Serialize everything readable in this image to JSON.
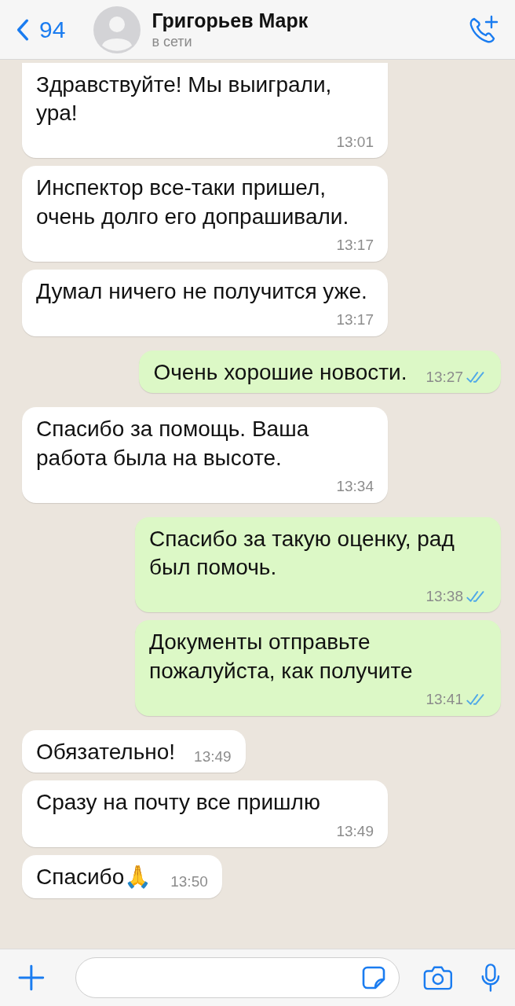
{
  "header": {
    "back_count": "94",
    "contact_name": "Григорьев Марк",
    "status": "в сети"
  },
  "messages": [
    {
      "kind": "incoming",
      "text": "Здравствуйте! Мы выиграли, ура!",
      "time": "13:01"
    },
    {
      "kind": "incoming",
      "text": "Инспектор все-таки пришел, очень долго его допрашивали.",
      "time": "13:17"
    },
    {
      "kind": "incoming",
      "text": "Думал ничего не получится уже.",
      "time": "13:17"
    },
    {
      "kind": "outgoing",
      "text": "Очень хорошие новости.",
      "time": "13:27",
      "read": true
    },
    {
      "kind": "incoming",
      "text": "Спасибо за помощь. Ваша работа была на высоте.",
      "time": "13:34"
    },
    {
      "kind": "outgoing",
      "text": "Спасибо за такую оценку, рад был помочь.",
      "time": "13:38",
      "read": true
    },
    {
      "kind": "outgoing",
      "text": "Документы отправьте пожалуйста, как получите",
      "time": "13:41",
      "read": true
    },
    {
      "kind": "incoming",
      "text": "Обязательно!",
      "time": "13:49"
    },
    {
      "kind": "incoming",
      "text": "Сразу на почту все пришлю",
      "time": "13:49"
    },
    {
      "kind": "incoming",
      "text": "Спасибо🙏",
      "time": "13:50"
    }
  ]
}
